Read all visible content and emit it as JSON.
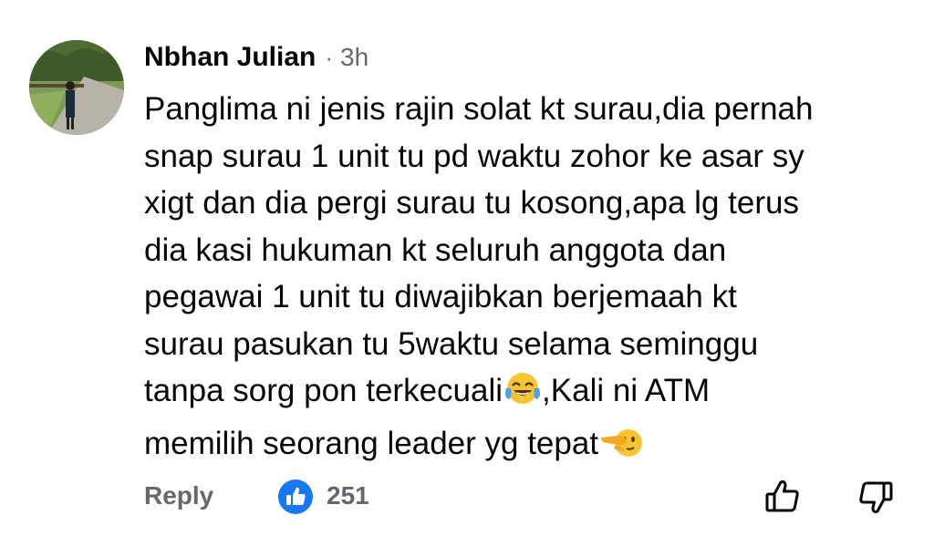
{
  "comment": {
    "author": "Nbhan Julian",
    "separator": "·",
    "time": "3h",
    "lines": [
      "Panglima ni jenis rajin solat kt surau,dia pernah",
      "snap surau 1 unit tu pd waktu zohor ke asar sy",
      "xigt dan dia pergi surau tu kosong,apa lg terus",
      "dia kasi hukuman kt seluruh anggota dan",
      "pegawai 1 unit tu diwajibkan berjemaah kt",
      "surau pasukan tu 5waktu selama seminggu",
      "tanpa sorg pon terkecuali",
      ",Kali ni ATM",
      "memilih seorang leader yg tepat"
    ],
    "emojis": [
      "tears-of-joy-emoji",
      "pointing-left-emoji"
    ]
  },
  "actions": {
    "reply_label": "Reply",
    "like_count": "251",
    "like_icon": "thumbs-up-icon",
    "dislike_icon": "thumbs-down-icon",
    "like_badge_color": "#1877f2",
    "muted_color": "#65676b"
  }
}
